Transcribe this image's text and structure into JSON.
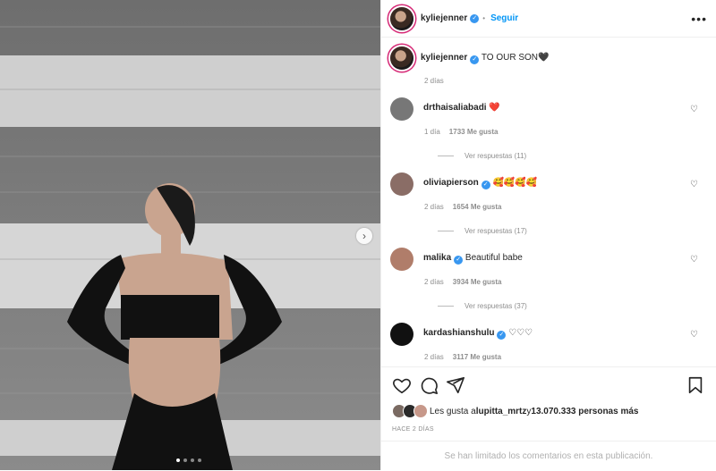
{
  "post": {
    "author": "kyliejenner",
    "follow_label": "Seguir",
    "more_icon": "more-dots-icon",
    "caption": "TO OUR SON🖤",
    "caption_time": "2 días",
    "carousel": {
      "pages": 4,
      "active": 1
    }
  },
  "comments": [
    {
      "user": "drthaisaliabadi",
      "verified": false,
      "text": "❤️",
      "time": "1 día",
      "likes": "1733 Me gusta",
      "replies": "Ver respuestas (11)"
    },
    {
      "user": "oliviapierson",
      "verified": true,
      "text": "🥰🥰🥰🥰",
      "time": "2 días",
      "likes": "1654 Me gusta",
      "replies": "Ver respuestas (17)"
    },
    {
      "user": "malika",
      "verified": true,
      "text": "Beautiful babe",
      "time": "2 días",
      "likes": "3934 Me gusta",
      "replies": "Ver respuestas (37)"
    },
    {
      "user": "kardashianshulu",
      "verified": true,
      "text": "♡♡♡",
      "time": "2 días",
      "likes": "3117 Me gusta",
      "replies": ""
    }
  ],
  "likes": {
    "prefix": "Les gusta a ",
    "first_user": "lupitta_mrtz",
    "middle": " y ",
    "count": "13.070.333 personas más"
  },
  "posted_ago": "HACE 2 DÍAS",
  "comments_limited": "Se han limitado los comentarios en esta publicación.",
  "colors": {
    "accent": "#0095f6",
    "verified": "#3897f0",
    "border": "#efefef"
  }
}
